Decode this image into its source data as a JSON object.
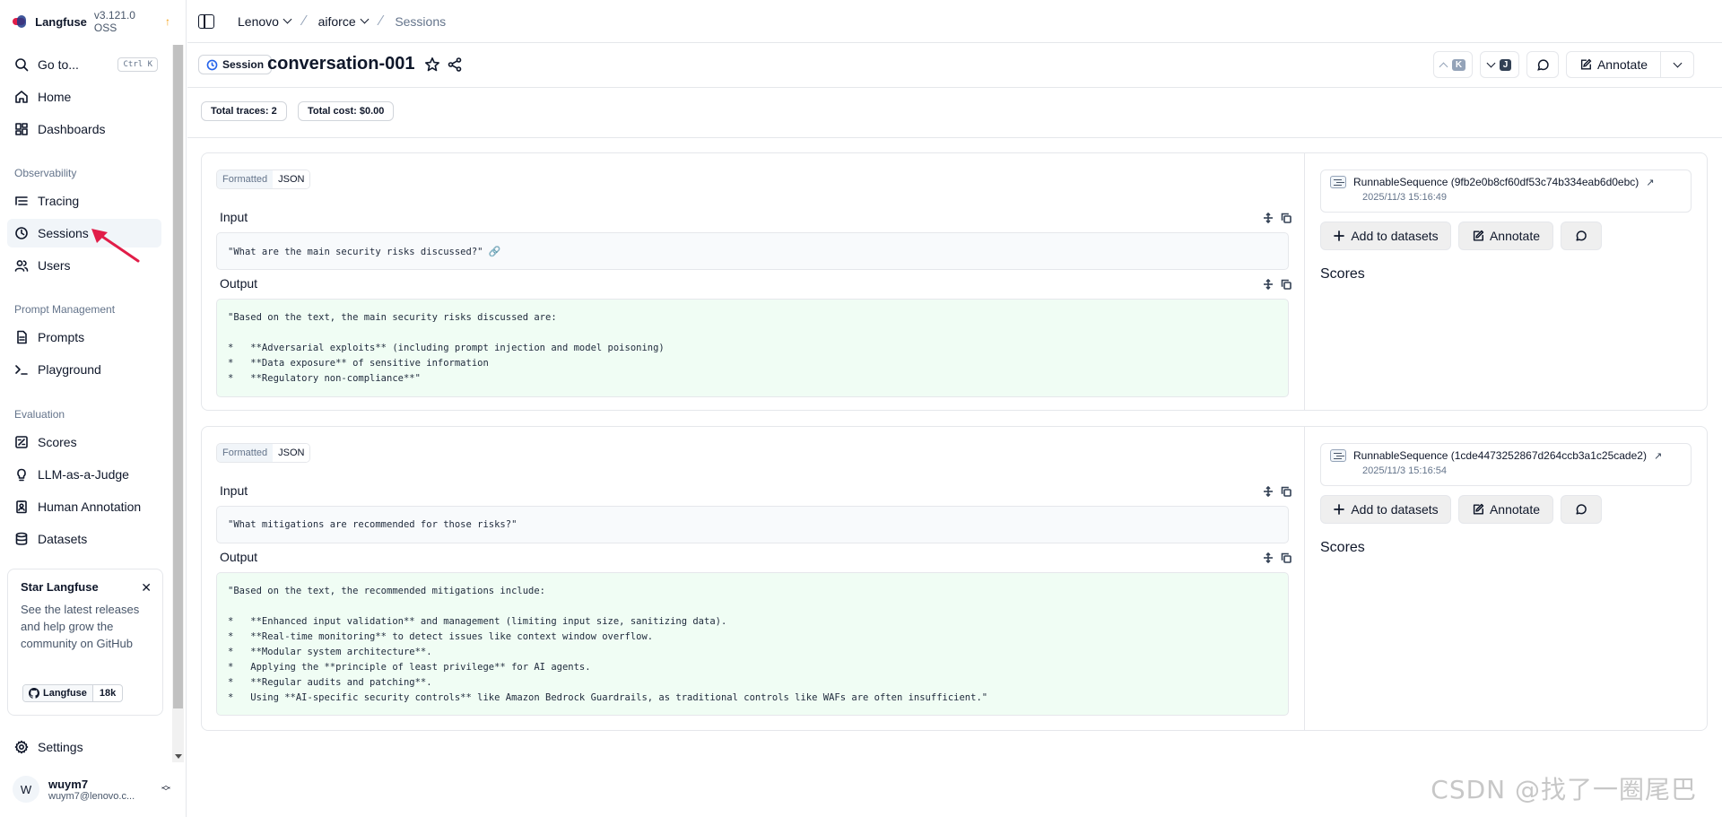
{
  "brand": {
    "name": "Langfuse",
    "version": "v3.121.0 OSS",
    "update_glyph": "↑"
  },
  "sidebar": {
    "goto": {
      "label": "Go to...",
      "shortcut": "Ctrl K"
    },
    "items_top": [
      {
        "label": "Home",
        "icon": "home-icon"
      },
      {
        "label": "Dashboards",
        "icon": "dashboard-icon"
      }
    ],
    "section_observability": "Observability",
    "items_observability": [
      {
        "label": "Tracing",
        "icon": "tracing-icon"
      },
      {
        "label": "Sessions",
        "icon": "clock-icon"
      },
      {
        "label": "Users",
        "icon": "users-icon"
      }
    ],
    "section_prompt": "Prompt Management",
    "items_prompt": [
      {
        "label": "Prompts",
        "icon": "file-icon"
      },
      {
        "label": "Playground",
        "icon": "terminal-icon"
      }
    ],
    "section_evaluation": "Evaluation",
    "items_evaluation": [
      {
        "label": "Scores",
        "icon": "score-icon"
      },
      {
        "label": "LLM-as-a-Judge",
        "icon": "lightbulb-icon"
      },
      {
        "label": "Human Annotation",
        "icon": "annotation-icon"
      },
      {
        "label": "Datasets",
        "icon": "database-icon"
      }
    ],
    "promo": {
      "title": "Star Langfuse",
      "text": "See the latest releases and help grow the community on GitHub",
      "badge_label": "Langfuse",
      "badge_count": "18k"
    },
    "settings": "Settings",
    "user": {
      "initial": "W",
      "name": "wuym7",
      "email": "wuym7@lenovo.c..."
    }
  },
  "breadcrumb": {
    "org": "Lenovo",
    "project": "aiforce",
    "page": "Sessions"
  },
  "session": {
    "badge": "Session",
    "title": "conversation-001",
    "prev_key": "K",
    "next_key": "J",
    "annotate": "Annotate"
  },
  "stats": {
    "traces": "Total traces: 2",
    "cost": "Total cost: $0.00"
  },
  "view_toggle": {
    "formatted": "Formatted",
    "json": "JSON"
  },
  "labels": {
    "input": "Input",
    "output": "Output",
    "scores": "Scores",
    "add_to_datasets": "Add to datasets",
    "annotate": "Annotate"
  },
  "traces": [
    {
      "name": "RunnableSequence (9fb2e0b8cf60df53c74b334eab6d0ebc)",
      "time": "2025/11/3 15:16:49",
      "input": "\"What are the main security risks discussed?\"",
      "output": "\"Based on the text, the main security risks discussed are:\n\n*   **Adversarial exploits** (including prompt injection and model poisoning)\n*   **Data exposure** of sensitive information\n*   **Regulatory non-compliance**\""
    },
    {
      "name": "RunnableSequence (1cde4473252867d264ccb3a1c25cade2)",
      "time": "2025/11/3 15:16:54",
      "input": "\"What mitigations are recommended for those risks?\"",
      "output": "\"Based on the text, the recommended mitigations include:\n\n*   **Enhanced input validation** and management (limiting input size, sanitizing data).\n*   **Real-time monitoring** to detect issues like context window overflow.\n*   **Modular system architecture**.\n*   Applying the **principle of least privilege** for AI agents.\n*   **Regular audits and patching**.\n*   Using **AI-specific security controls** like Amazon Bedrock Guardrails, as traditional controls like WAFs are often insufficient.\""
    }
  ],
  "watermark": "CSDN @找了一圈尾巴",
  "colors": {
    "accent": "#2563eb",
    "output_bg": "#f0fdf4",
    "input_bg": "#f8fafc",
    "pointer": "#e11d48"
  }
}
